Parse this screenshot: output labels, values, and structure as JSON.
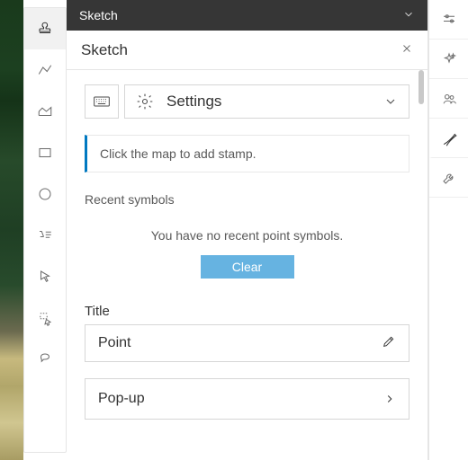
{
  "header": {
    "title": "Sketch"
  },
  "subheader": {
    "title": "Sketch"
  },
  "settings": {
    "label": "Settings"
  },
  "hint": {
    "text": "Click the map to add stamp."
  },
  "recent": {
    "label": "Recent symbols",
    "empty": "You have no recent point symbols.",
    "clear": "Clear"
  },
  "title_field": {
    "label": "Title",
    "value": "Point"
  },
  "popup": {
    "label": "Pop-up"
  }
}
